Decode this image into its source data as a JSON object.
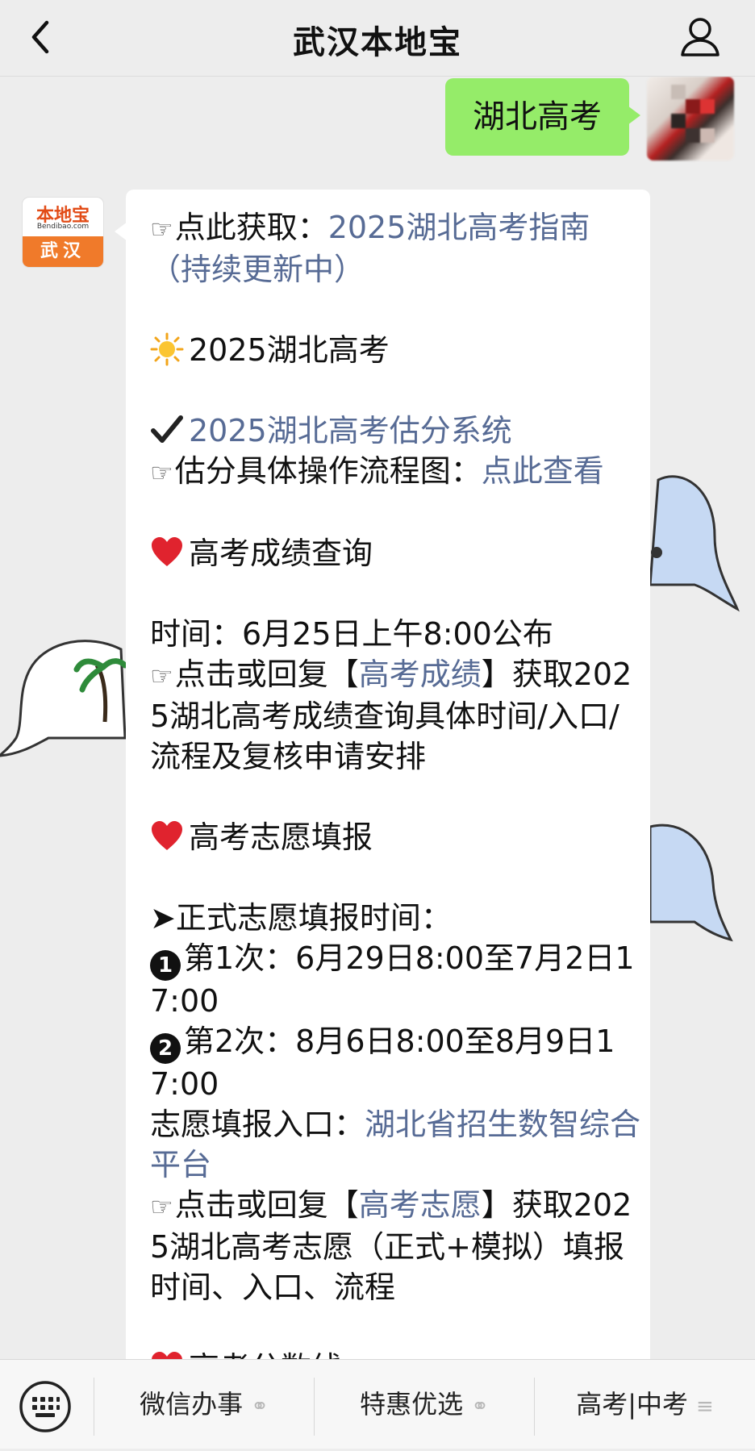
{
  "header": {
    "title": "武汉本地宝"
  },
  "outgoing": {
    "text": "湖北高考"
  },
  "bot_avatar": {
    "logo_text": "本地宝",
    "logo_url_text": "Bendibao.com",
    "city": "武汉"
  },
  "message": {
    "l1_prefix": "点此获取：",
    "l1_link": "2025湖北高考指南（持续更新中）",
    "h1": "2025湖北高考",
    "l2_link": "2025湖北高考估分系统",
    "l3_prefix": "估分具体操作流程图：",
    "l3_link": "点此查看",
    "h2": "高考成绩查询",
    "l4": "时间：6月25日上午8:00公布",
    "l5_prefix": "点击或回复【",
    "l5_link": "高考成绩",
    "l5_suffix": "】获取2025湖北高考成绩查询具体时间/入口/流程及复核申请安排",
    "h3": "高考志愿填报",
    "l6": "➤正式志愿填报时间：",
    "l7_num": "1",
    "l7": "第1次：6月29日8:00至7月2日17:00",
    "l8_num": "2",
    "l8": "第2次：8月6日8:00至8月9日17:00",
    "l9_prefix": "志愿填报入口：",
    "l9_link": "湖北省招生数智综合平台",
    "l10_prefix": "点击或回复【",
    "l10_link": "高考志愿",
    "l10_suffix": "】获取2025湖北高考志愿（正式+模拟）填报时间、入口、流程",
    "h4_partial": "高考分数线"
  },
  "bottom_menu": {
    "item1": "微信办事",
    "item2": "特惠优选",
    "item3": "高考|中考"
  },
  "colors": {
    "link": "#576b95",
    "outgoing_bubble": "#95ec69",
    "background": "#ededed"
  }
}
